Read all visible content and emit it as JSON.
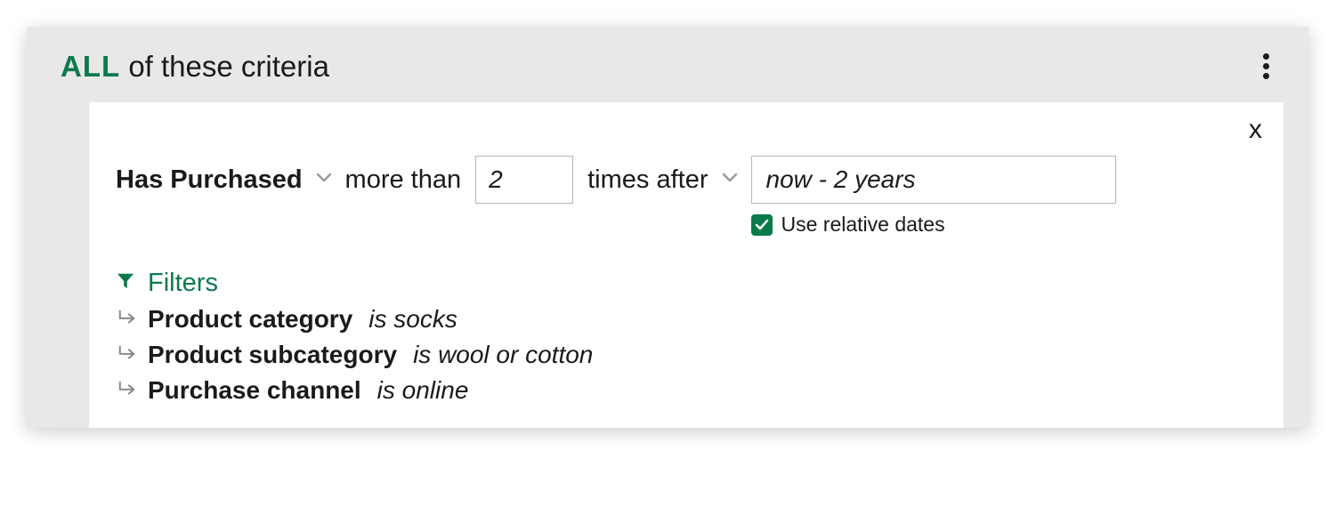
{
  "header": {
    "all_word": "ALL",
    "rest": " of these criteria"
  },
  "criteria": {
    "has_purchased": "Has Purchased",
    "more_than": "more than",
    "count_value": "2",
    "times_after": "times after",
    "date_value": "now - 2 years",
    "relative_label": "Use relative dates"
  },
  "filters": {
    "title": "Filters",
    "rows": [
      {
        "name": "Product category",
        "cond": "is socks"
      },
      {
        "name": "Product subcategory",
        "cond": "is wool or cotton"
      },
      {
        "name": "Purchase channel",
        "cond": "is online"
      }
    ]
  },
  "close_label": "x"
}
